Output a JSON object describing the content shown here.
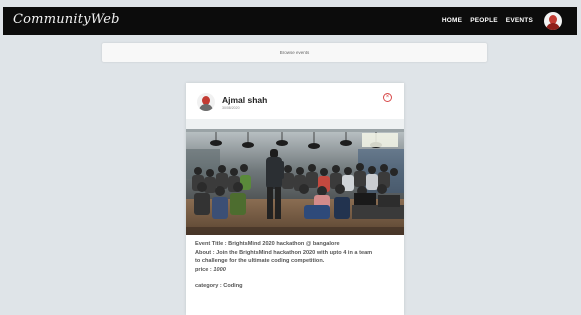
{
  "app": {
    "logo": "CommunityWeb"
  },
  "nav": {
    "items": [
      {
        "label": "HOME"
      },
      {
        "label": "PEOPLE"
      },
      {
        "label": "EVENTS"
      }
    ]
  },
  "browse": {
    "label": "Browse events"
  },
  "card": {
    "author": "Ajmal shah",
    "date": "30/08/2020",
    "details": {
      "title_line": "Event Title : BrightsMind 2020 hackathon @ bangalore",
      "about_line1": "About : Join the BrightsMind hackathon 2020 with upto 4 in a team",
      "about_line2": "to challenge for the ultimate coding competition.",
      "price_label": "price :",
      "price_value": "1000",
      "category_line": "category : Coding"
    }
  },
  "icons": {
    "close": "close-circle-icon",
    "avatar": "user-avatar"
  },
  "colors": {
    "topbar": "#0c0c0c",
    "background": "#dfe4e8",
    "close_accent": "#d84a4a"
  }
}
